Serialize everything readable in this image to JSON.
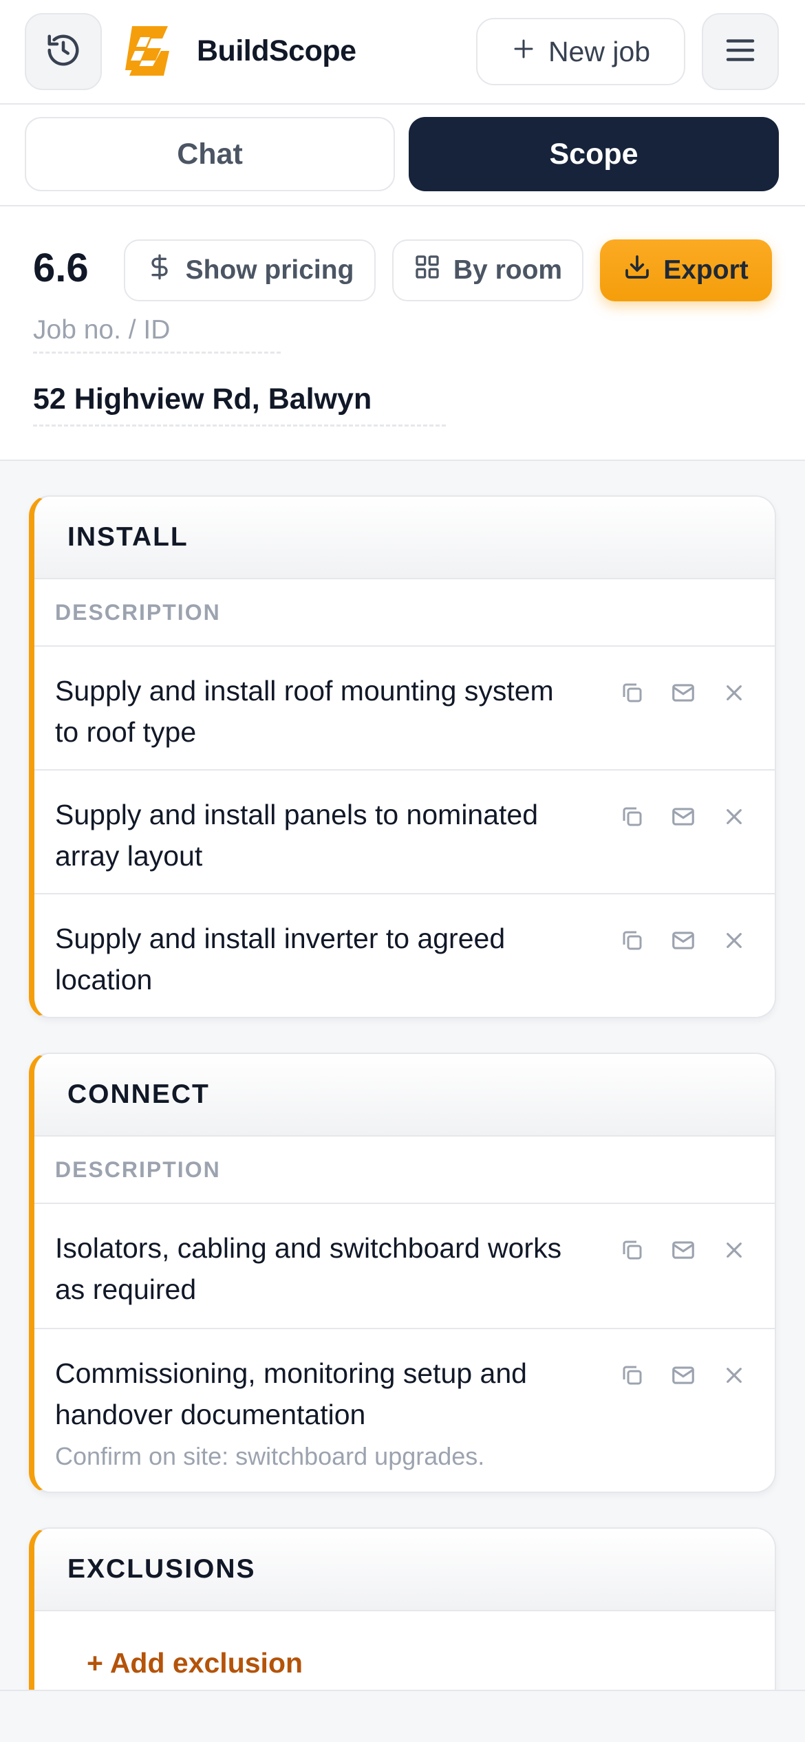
{
  "header": {
    "brand": "BuildScope",
    "new_job_label": "New job",
    "history_icon": "history-icon",
    "menu_icon": "hamburger-menu-icon",
    "accent": "#f59e0b"
  },
  "tabs": [
    {
      "label": "Chat",
      "active": false
    },
    {
      "label": "Scope",
      "active": true
    }
  ],
  "toolbar": {
    "version": "6.6",
    "show_pricing_label": "Show pricing",
    "by_room_label": "By room",
    "export_label": "Export"
  },
  "job": {
    "job_no_placeholder": "Job no. / ID",
    "address": "52 Highview Rd, Balwyn"
  },
  "sections": {
    "install": {
      "title": "INSTALL",
      "column_header": "DESCRIPTION",
      "items": [
        {
          "text": "Supply and install roof mounting system to roof type"
        },
        {
          "text": "Supply and install panels to nominated array layout"
        },
        {
          "text": "Supply and install inverter to agreed location"
        }
      ]
    },
    "connect": {
      "title": "CONNECT",
      "column_header": "DESCRIPTION",
      "items": [
        {
          "text": "Isolators, cabling and switchboard works as required"
        },
        {
          "text": "Commissioning, monitoring setup and handover documentation",
          "note": "Confirm on site: switchboard upgrades."
        }
      ]
    },
    "exclusions": {
      "title": "EXCLUSIONS",
      "add_label": "+ Add exclusion"
    }
  }
}
